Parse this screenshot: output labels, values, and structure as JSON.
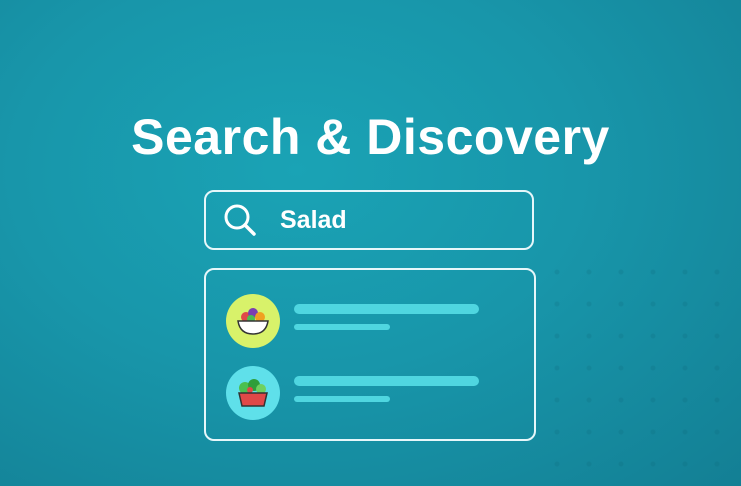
{
  "heading": {
    "title": "Search & Discovery"
  },
  "search": {
    "query": "Salad",
    "icon": "search-icon"
  },
  "results": {
    "items": [
      {
        "thumb_icon": "fruit-bowl-icon",
        "thumb_color": "#d8f26a"
      },
      {
        "thumb_icon": "salad-bowl-icon",
        "thumb_color": "#5fe0ea"
      }
    ],
    "line_color": "#4fd6e0"
  },
  "colors": {
    "background": "#1896aa",
    "text": "#ffffff",
    "border": "#e6f7fa"
  }
}
